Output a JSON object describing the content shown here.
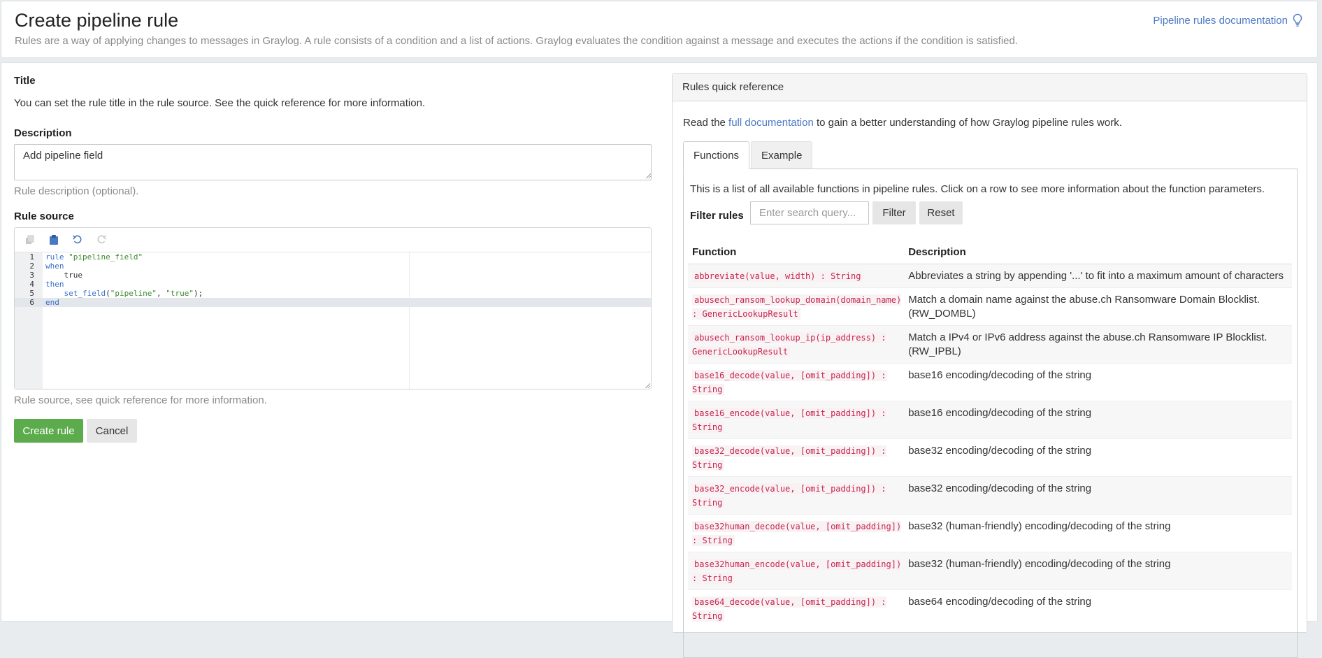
{
  "header": {
    "title": "Create pipeline rule",
    "description": "Rules are a way of applying changes to messages in Graylog. A rule consists of a condition and a list of actions. Graylog evaluates the condition against a message and executes the actions if the condition is satisfied.",
    "doc_link": "Pipeline rules documentation",
    "doc_icon": "lightbulb-icon"
  },
  "form": {
    "title_label": "Title",
    "title_help": "You can set the rule title in the rule source. See the quick reference for more information.",
    "description_label": "Description",
    "description_value": "Add pipeline field",
    "description_help": "Rule description (optional).",
    "source_label": "Rule source",
    "source_help": "Rule source, see quick reference for more information.",
    "toolbar_icons": [
      "copy-icon",
      "paste-icon",
      "undo-icon",
      "redo-icon"
    ],
    "code_lines": [
      {
        "num": "1",
        "text": "rule \"pipeline_field\""
      },
      {
        "num": "2",
        "text": "when"
      },
      {
        "num": "3",
        "text": "    true"
      },
      {
        "num": "4",
        "text": "then"
      },
      {
        "num": "5",
        "text": "    set_field(\"pipeline\", \"true\");"
      },
      {
        "num": "6",
        "text": "end"
      }
    ],
    "create_button": "Create rule",
    "cancel_button": "Cancel"
  },
  "quick_reference": {
    "title": "Rules quick reference",
    "intro_before": "Read the ",
    "intro_link": "full documentation",
    "intro_after": " to gain a better understanding of how Graylog pipeline rules work.",
    "tabs": [
      "Functions",
      "Example"
    ],
    "functions_intro": "This is a list of all available functions in pipeline rules. Click on a row to see more information about the function parameters.",
    "filter_label": "Filter rules",
    "filter_placeholder": "Enter search query...",
    "filter_button": "Filter",
    "reset_button": "Reset",
    "columns": [
      "Function",
      "Description"
    ],
    "functions": [
      {
        "sig": "abbreviate(value, width) : String",
        "desc": "Abbreviates a string by appending '...' to fit into a maximum amount of characters"
      },
      {
        "sig": "abusech_ransom_lookup_domain(domain_name) : GenericLookupResult",
        "desc": "Match a domain name against the abuse.ch Ransomware Domain Blocklist. (RW_DOMBL)"
      },
      {
        "sig": "abusech_ransom_lookup_ip(ip_address) : GenericLookupResult",
        "desc": "Match a IPv4 or IPv6 address against the abuse.ch Ransomware IP Blocklist. (RW_IPBL)"
      },
      {
        "sig": "base16_decode(value, [omit_padding]) : String",
        "desc": "base16 encoding/decoding of the string"
      },
      {
        "sig": "base16_encode(value, [omit_padding]) : String",
        "desc": "base16 encoding/decoding of the string"
      },
      {
        "sig": "base32_decode(value, [omit_padding]) : String",
        "desc": "base32 encoding/decoding of the string"
      },
      {
        "sig": "base32_encode(value, [omit_padding]) : String",
        "desc": "base32 encoding/decoding of the string"
      },
      {
        "sig": "base32human_decode(value, [omit_padding]) : String",
        "desc": "base32 (human-friendly) encoding/decoding of the string"
      },
      {
        "sig": "base32human_encode(value, [omit_padding]) : String",
        "desc": "base32 (human-friendly) encoding/decoding of the string"
      },
      {
        "sig": "base64_decode(value, [omit_padding]) : String",
        "desc": "base64 encoding/decoding of the string"
      }
    ]
  }
}
